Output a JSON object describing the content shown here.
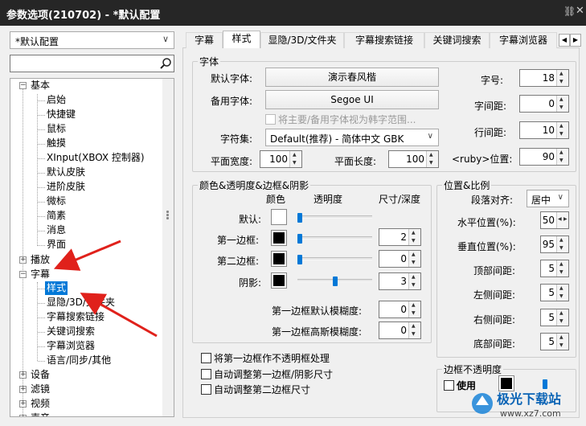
{
  "window": {
    "title": "参数选项(210702) - *默认配置",
    "pin_icon": "pin-icon",
    "close_icon": "close-icon"
  },
  "left": {
    "preset": "*默认配置",
    "search_placeholder": "",
    "tree": {
      "basic": "基本",
      "basic_children": [
        "启始",
        "快捷键",
        "鼠标",
        "触摸",
        "XInput(XBOX 控制器)",
        "默认皮肤",
        "进阶皮肤",
        "微标",
        "简素",
        "消息",
        "界面"
      ],
      "playback": "播放",
      "subtitle": "字幕",
      "subtitle_children": [
        "样式",
        "显隐/3D/文件夹",
        "字幕搜索链接",
        "关键词搜索",
        "字幕浏览器",
        "语言/同步/其他"
      ],
      "device": "设备",
      "filter": "滤镜",
      "video": "视频",
      "audio": "声音"
    }
  },
  "tabs": [
    "字幕",
    "样式",
    "显隐/3D/文件夹",
    "字幕搜索链接",
    "关键词搜索",
    "字幕浏览器"
  ],
  "active_tab": "样式",
  "font_group": {
    "legend": "字体",
    "default_font_label": "默认字体:",
    "default_font": "演示春风楷",
    "backup_font_label": "备用字体:",
    "backup_font": "Segoe UI",
    "korean_check": "将主要/备用字体视为韩字范围...",
    "charset_label": "字符集:",
    "charset": "Default(推荐) - 简体中文 GBK",
    "plane_width_label": "平面宽度:",
    "plane_width": "100",
    "plane_length_label": "平面长度:",
    "plane_length": "100",
    "size_label": "字号:",
    "size": "18",
    "char_spacing_label": "字间距:",
    "char_spacing": "0",
    "line_spacing_label": "行间距:",
    "line_spacing": "10",
    "ruby_label": "<ruby>位置:",
    "ruby": "90"
  },
  "color_group": {
    "legend": "颜色&透明度&边框&阴影",
    "col_color": "颜色",
    "col_opacity": "透明度",
    "col_size": "尺寸/深度",
    "rows": [
      {
        "label": "默认:",
        "color": "#ffffff",
        "opacity": 0.0,
        "size": ""
      },
      {
        "label": "第一边框:",
        "color": "#000000",
        "opacity": 0.0,
        "size": "2"
      },
      {
        "label": "第二边框:",
        "color": "#000000",
        "opacity": 0.0,
        "size": "0"
      },
      {
        "label": "阴影:",
        "color": "#000000",
        "opacity": 0.5,
        "size": "3"
      }
    ],
    "blur1_label": "第一边框默认模糊度:",
    "blur1": "0",
    "blur2_label": "第一边框高斯模糊度:",
    "blur2": "0"
  },
  "options": [
    "将第一边框作不透明框处理",
    "自动调整第一边框/阴影尺寸",
    "自动调整第二边框尺寸"
  ],
  "pos_group": {
    "legend": "位置&比例",
    "align_label": "段落对齐:",
    "align": "居中",
    "hpos_label": "水平位置(%):",
    "hpos": "50",
    "vpos_label": "垂直位置(%):",
    "vpos": "95",
    "top_label": "顶部间距:",
    "top": "5",
    "left_label": "左侧间距:",
    "left": "5",
    "right_label": "右侧间距:",
    "right": "5",
    "bottom_label": "底部间距:",
    "bottom": "5"
  },
  "border_group": {
    "legend": "边框不透明度",
    "use_label": "使用",
    "color": "#000000"
  },
  "watermark": {
    "text": "极光下载站",
    "url": "www.xz7.com"
  },
  "accent": "#0078d7",
  "arrow_color": "#e0211b"
}
